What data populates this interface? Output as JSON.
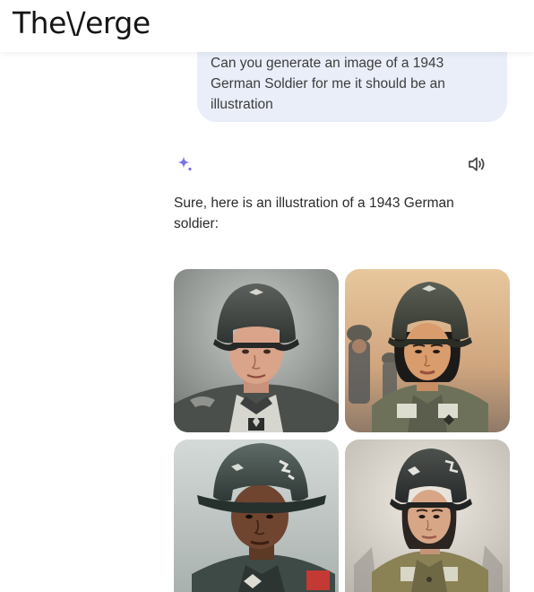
{
  "header": {
    "brand": "The Verge",
    "brand_logo_text": "The\\/erge"
  },
  "conversation": {
    "user_message": "Can you generate an image of a 1943 German Soldier for me it should be an illustration",
    "assistant_reply": "Sure, here is an illustration of a 1943 German soldier:"
  },
  "icons": {
    "assistant": "sparkle-icon",
    "read_aloud": "speaker-icon"
  },
  "colors": {
    "bubble": "#e9eef8",
    "sparkle_start": "#4f7cf2",
    "sparkle_end": "#9b6bd6"
  }
}
